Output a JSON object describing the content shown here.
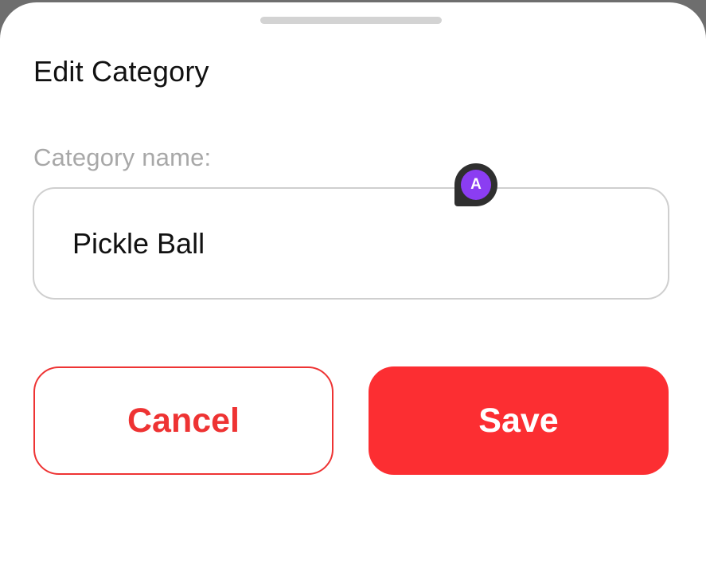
{
  "dialog": {
    "title": "Edit Category",
    "field_label": "Category name:",
    "field_value": "Pickle Ball",
    "marker_letter": "A",
    "cancel_label": "Cancel",
    "save_label": "Save"
  },
  "colors": {
    "accent": "#fc2e32",
    "cancel_text": "#ee3333",
    "marker": "#8b3df2"
  }
}
